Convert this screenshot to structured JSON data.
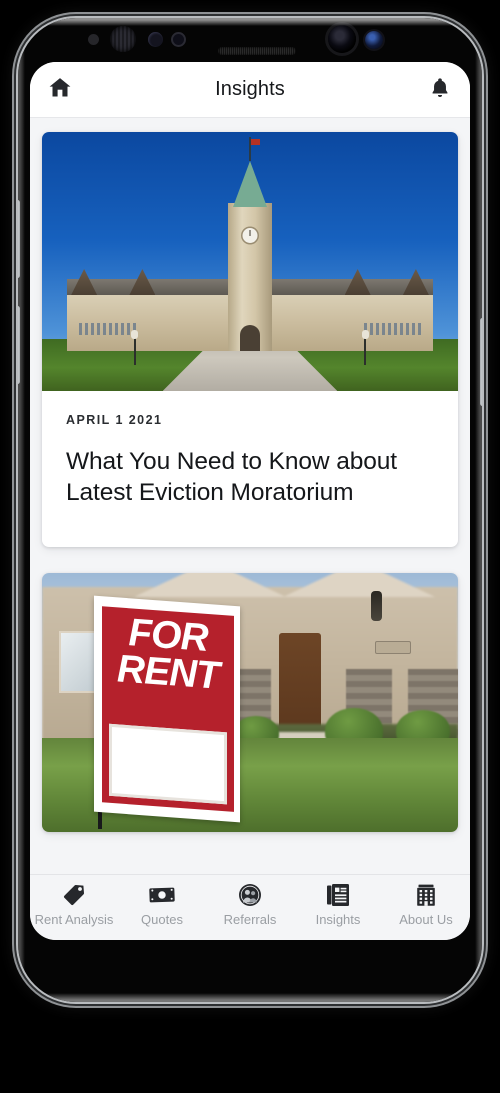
{
  "header": {
    "title": "Insights",
    "home_icon": "home-icon",
    "bell_icon": "bell-icon"
  },
  "feed": {
    "articles": [
      {
        "date": "APRIL 1 2021",
        "title": "What You Need to Know about Latest Eviction Moratorium",
        "image_alt": "parliament-hill-photo"
      },
      {
        "date": "",
        "title": "",
        "image_alt": "for-rent-sign-photo",
        "sign_line1": "FOR",
        "sign_line2": "RENT"
      }
    ]
  },
  "tab_bar": {
    "items": [
      {
        "label": "Rent Analysis",
        "icon": "price-tag-icon"
      },
      {
        "label": "Quotes",
        "icon": "banknote-icon"
      },
      {
        "label": "Referrals",
        "icon": "people-circle-icon"
      },
      {
        "label": "Insights",
        "icon": "article-icon"
      },
      {
        "label": "About Us",
        "icon": "building-icon"
      }
    ]
  },
  "colors": {
    "screen_background": "#f4f5f7",
    "card_background": "#ffffff",
    "icon_dark": "#26282c",
    "tab_label": "#9a9ea3",
    "title_text": "#15171a",
    "sign_red": "#b5212c"
  }
}
